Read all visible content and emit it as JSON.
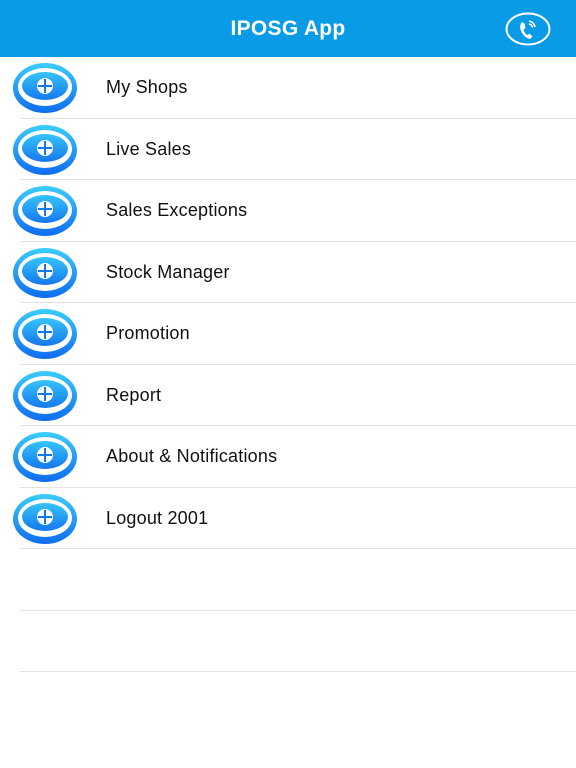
{
  "header": {
    "title": "IPOSG App",
    "phone_icon": "phone-icon"
  },
  "menu": {
    "icon": "iposg-logo-icon",
    "items": [
      {
        "label": "My Shops"
      },
      {
        "label": "Live Sales"
      },
      {
        "label": "Sales Exceptions"
      },
      {
        "label": "Stock Manager"
      },
      {
        "label": "Promotion"
      },
      {
        "label": "Report"
      },
      {
        "label": "About & Notifications"
      },
      {
        "label": "Logout 2001"
      }
    ]
  },
  "colors": {
    "navbar": "#0a9be6",
    "icon_light": "#3ccdfc",
    "icon_dark": "#0f6cf0",
    "separator": "#e3e3e3"
  }
}
